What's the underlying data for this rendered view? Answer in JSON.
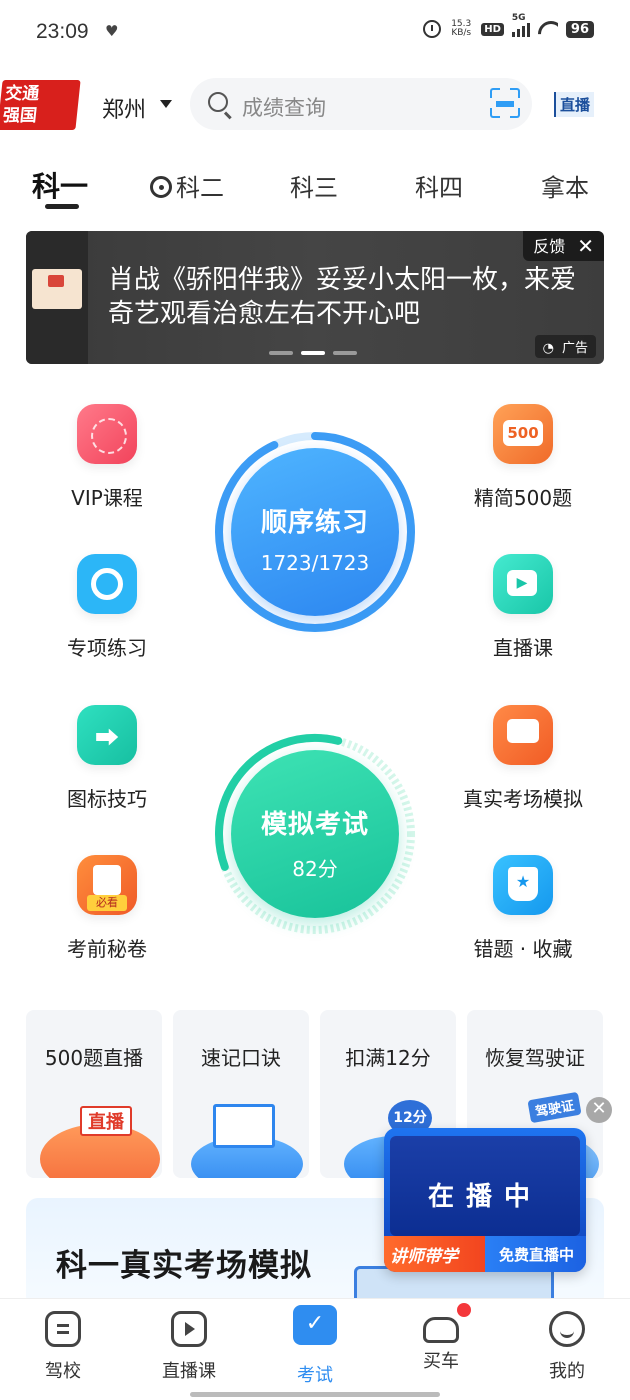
{
  "status_bar": {
    "time": "23:09",
    "speed_value": "15.3",
    "speed_unit": "KB/s",
    "hd_badge": "HD",
    "network": "5G",
    "battery": "96"
  },
  "header": {
    "logo_line1": "交通",
    "logo_line2": "强国",
    "city": "郑州",
    "search_placeholder": "成绩查询",
    "live_badge": "直播"
  },
  "tabs": [
    {
      "label": "科一",
      "active": true
    },
    {
      "label": "科二",
      "active": false
    },
    {
      "label": "科三",
      "active": false
    },
    {
      "label": "科四",
      "active": false
    },
    {
      "label": "拿本",
      "active": false
    }
  ],
  "banner": {
    "text": "肖战《骄阳伴我》妥妥小太阳一枚，来爱奇艺观看治愈左右不开心吧",
    "feedback": "反馈",
    "ad_label": "广告",
    "dots_count": 3,
    "active_dot": 1
  },
  "features_left": [
    {
      "label": "VIP课程",
      "icon": "vip-course-icon"
    },
    {
      "label": "专项练习",
      "icon": "special-practice-icon"
    },
    {
      "label": "图标技巧",
      "icon": "sign-tips-icon"
    },
    {
      "label": "考前秘卷",
      "icon": "secret-paper-icon"
    }
  ],
  "features_right": [
    {
      "label": "精简500题",
      "icon": "500-questions-icon"
    },
    {
      "label": "直播课",
      "icon": "live-class-icon"
    },
    {
      "label": "真实考场模拟",
      "icon": "exam-room-icon"
    },
    {
      "label": "错题 · 收藏",
      "icon": "wrong-favorites-icon"
    }
  ],
  "sequential_practice": {
    "title": "顺序练习",
    "progress": "1723/1723",
    "progress_fraction": 1.0,
    "color": "#2c86f0"
  },
  "mock_exam": {
    "title": "模拟考试",
    "score": "82分",
    "score_fraction": 0.82,
    "color": "#18c29a"
  },
  "cards": [
    {
      "title": "500题直播",
      "tag": "直播"
    },
    {
      "title": "速记口诀",
      "tag": ""
    },
    {
      "title": "扣满12分",
      "tag": "12分"
    },
    {
      "title": "恢复驾驶证",
      "tag": "驾驶证"
    }
  ],
  "mock_section": {
    "title": "科一真实考场模拟"
  },
  "float_live": {
    "status": "在播中",
    "left_label": "讲师带学",
    "right_label": "免费直播中"
  },
  "bottom_nav": [
    {
      "label": "驾校",
      "active": false
    },
    {
      "label": "直播课",
      "active": false
    },
    {
      "label": "考试",
      "active": true
    },
    {
      "label": "买车",
      "active": false,
      "dot": true
    },
    {
      "label": "我的",
      "active": false
    }
  ]
}
